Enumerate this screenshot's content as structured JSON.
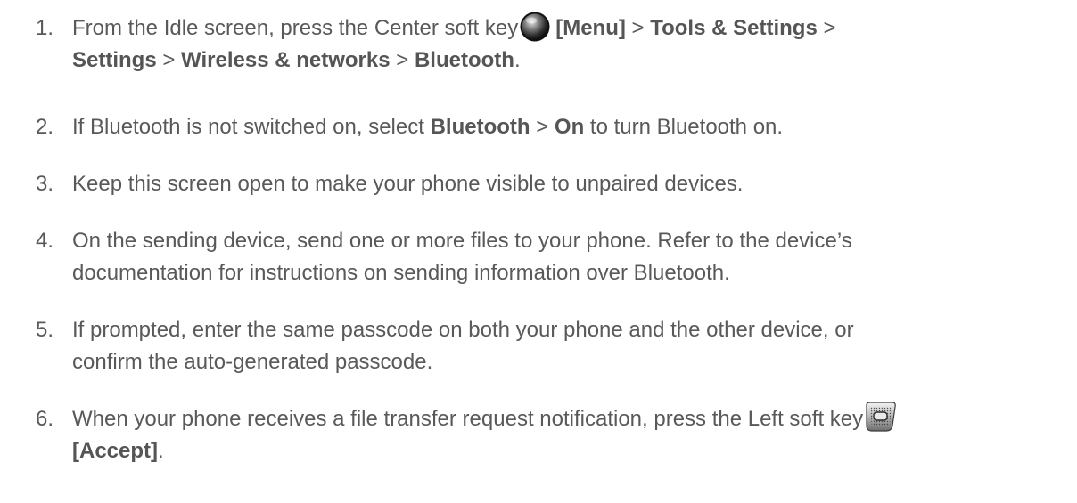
{
  "steps": [
    {
      "number": "1.",
      "line1": {
        "t1": "From the Idle screen, press the Center soft key",
        "b1": "[Menu]",
        "t2": " > ",
        "b2": "Tools & Settings",
        "t3": " >"
      },
      "line2": {
        "b1": "Settings",
        "t1": " > ",
        "b2": "Wireless & networks",
        "t2": " > ",
        "b3": "Bluetooth",
        "t3": "."
      },
      "icon": "center-soft-key-icon"
    },
    {
      "number": "2.",
      "t1": "If Bluetooth is not switched on, select ",
      "b1": "Bluetooth",
      "t2": " > ",
      "b2": "On",
      "t3": " to turn Bluetooth on."
    },
    {
      "number": "3.",
      "text": "Keep this screen open to make your phone visible to unpaired devices."
    },
    {
      "number": "4.",
      "line1": "On the sending device, send one or more files to your phone. Refer to the device’s",
      "line2": "documentation for instructions on sending information over Bluetooth."
    },
    {
      "number": "5.",
      "line1": "If prompted, enter the same passcode on both your phone and the other device, or",
      "line2": "confirm the auto-generated passcode."
    },
    {
      "number": "6.",
      "line1": "When your phone receives a file transfer request notification, press the Left soft key",
      "line2_bold": "[Accept]",
      "line2_tail": ".",
      "icon": "left-soft-key-icon"
    }
  ]
}
